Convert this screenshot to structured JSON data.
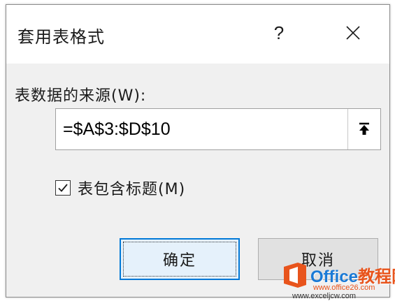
{
  "dialog": {
    "title": "套用表格式",
    "help_label": "?",
    "close_icon": "close-icon"
  },
  "source": {
    "label": "表数据的来源(W):",
    "value": "=$A$3:$D$10",
    "collapse_icon": "collapse-dialog-icon"
  },
  "header_option": {
    "label": "表包含标题(M)",
    "checked": true
  },
  "buttons": {
    "ok": "确定",
    "cancel": "取消"
  },
  "watermark": {
    "brand_prefix": "Office",
    "brand_suffix": "教程网",
    "url": "www.office26.com",
    "url2": "www.exceljcw.com"
  },
  "colors": {
    "focus_border": "#0078d7",
    "dialog_body": "#f0f0f0"
  }
}
